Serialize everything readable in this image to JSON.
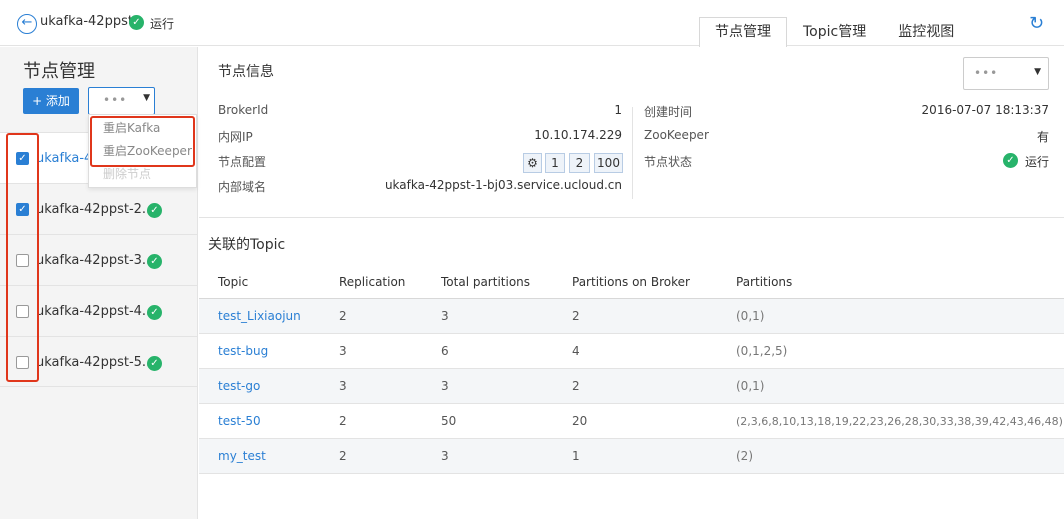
{
  "header": {
    "back_icon": "arrow-left-icon",
    "title": "ukafka-42ppst",
    "status": "运行",
    "tabs": [
      {
        "label": "节点管理",
        "active": true
      },
      {
        "label": "Topic管理",
        "active": false
      },
      {
        "label": "监控视图",
        "active": false
      }
    ],
    "refresh_icon": "refresh-icon"
  },
  "sidebar": {
    "title": "节点管理",
    "add_label": "+ 添加",
    "more_label": "•••",
    "dropdown": {
      "items": [
        {
          "label": "重启Kafka"
        },
        {
          "label": "重启ZooKeeper"
        },
        {
          "label": "删除节点"
        }
      ]
    },
    "nodes": [
      {
        "name": "ukafka-42ppst-1",
        "checked": true
      },
      {
        "name": "ukafka-42ppst-2...",
        "checked": true
      },
      {
        "name": "ukafka-42ppst-3...",
        "checked": false
      },
      {
        "name": "ukafka-42ppst-4...",
        "checked": false
      },
      {
        "name": "ukafka-42ppst-5...",
        "checked": false
      }
    ]
  },
  "node_info": {
    "title": "节点信息",
    "more_label": "•••",
    "broker_id_label": "BrokerId",
    "broker_id": "1",
    "intranet_ip_label": "内网IP",
    "intranet_ip": "10.10.174.229",
    "config_label": "节点配置",
    "config_values": [
      "1",
      "2",
      "100"
    ],
    "domain_label": "内部域名",
    "domain": "ukafka-42ppst-1-bj03.service.ucloud.cn",
    "created_label": "创建时间",
    "created": "2016-07-07 18:13:37",
    "zookeeper_label": "ZooKeeper",
    "zookeeper": "有",
    "status_label": "节点状态",
    "status": "运行"
  },
  "topics": {
    "title": "关联的Topic",
    "columns": [
      "Topic",
      "Replication",
      "Total partitions",
      "Partitions on Broker",
      "Partitions"
    ],
    "rows": [
      {
        "topic": "test_Lixiaojun",
        "replication": "2",
        "total": "3",
        "on_broker": "2",
        "partitions": "(0,1)"
      },
      {
        "topic": "test-bug",
        "replication": "3",
        "total": "6",
        "on_broker": "4",
        "partitions": "(0,1,2,5)"
      },
      {
        "topic": "test-go",
        "replication": "3",
        "total": "3",
        "on_broker": "2",
        "partitions": "(0,1)"
      },
      {
        "topic": "test-50",
        "replication": "2",
        "total": "50",
        "on_broker": "20",
        "partitions": "(2,3,6,8,10,13,18,19,22,23,26,28,30,33,38,39,42,43,46,48)"
      },
      {
        "topic": "my_test",
        "replication": "2",
        "total": "3",
        "on_broker": "1",
        "partitions": "(2)"
      }
    ]
  },
  "colors": {
    "accent": "#2a7fd4",
    "ok": "#27b36a",
    "highlight": "#e0361b"
  }
}
